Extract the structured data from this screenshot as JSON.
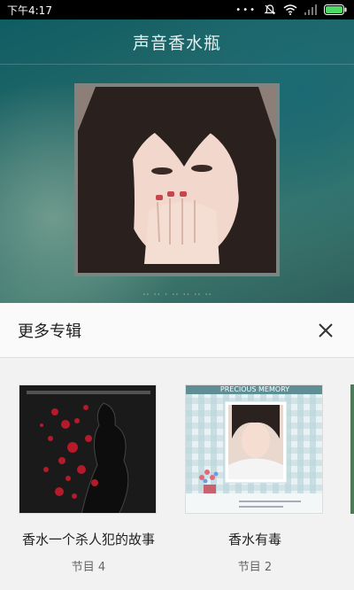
{
  "status_bar": {
    "time": "下午4:17",
    "icons": [
      "more-dots-icon",
      "mute-icon",
      "wifi-icon",
      "signal-icon",
      "battery-icon"
    ]
  },
  "player": {
    "title": "声音香水瓶",
    "caption": "·· ·· · ·· ·· ·· ··"
  },
  "sheet": {
    "title": "更多专辑",
    "close_icon": "close-icon"
  },
  "albums": [
    {
      "name": "香水一个杀人犯的故事",
      "count": "节目 4"
    },
    {
      "name": "香水有毒",
      "count": "节目 2",
      "cover_banner": "PRECIOUS MEMORY"
    }
  ],
  "colors": {
    "accent_battery": "#4cd964",
    "sheet_bg": "#f2f2f2",
    "hero_teal": "#1b6a73"
  }
}
